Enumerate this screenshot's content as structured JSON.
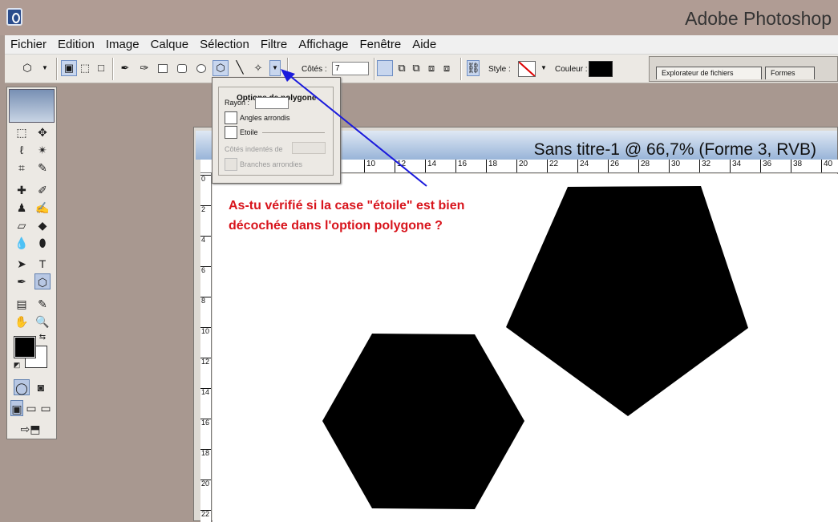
{
  "window": {
    "app_title": "Adobe Photoshop"
  },
  "menu": [
    "Fichier",
    "Edition",
    "Image",
    "Calque",
    "Sélection",
    "Filtre",
    "Affichage",
    "Fenêtre",
    "Aide"
  ],
  "options_bar": {
    "cotes_label": "Côtés :",
    "cotes_value": "7",
    "style_label": "Style :",
    "couleur_label": "Couleur :",
    "couleur_value": "#000000"
  },
  "palette_tabs": [
    "Explorateur de fichiers",
    "Formes"
  ],
  "polygon_options": {
    "title": "Options de polygone",
    "rayon_label": "Rayon :",
    "angles_arrondis": {
      "label": "Angles arrondis",
      "checked": false
    },
    "etoile": {
      "label": "Etoile",
      "checked": false
    },
    "cotes_indentes_label": "Côtés indentés de",
    "branches_arrondies": {
      "label": "Branches arrondies",
      "checked": false
    }
  },
  "document": {
    "title": "Sans titre-1 @ 66,7% (Forme 3, RVB)",
    "ruler_top": [
      "10",
      "12",
      "14",
      "16",
      "18",
      "20",
      "22",
      "24",
      "26",
      "28",
      "30",
      "32",
      "34",
      "36",
      "38",
      "40"
    ],
    "ruler_left": [
      "0",
      "2",
      "4",
      "6",
      "8",
      "10",
      "12",
      "14",
      "16",
      "18",
      "20",
      "22"
    ]
  },
  "annotation": "As-tu vérifié si la case \"étoile\" est bien décochée dans l'option polygone ?",
  "colors": {
    "foreground": "#000000",
    "background": "#ffffff",
    "annotation": "#d8141c",
    "arrow": "#1a1adc"
  }
}
